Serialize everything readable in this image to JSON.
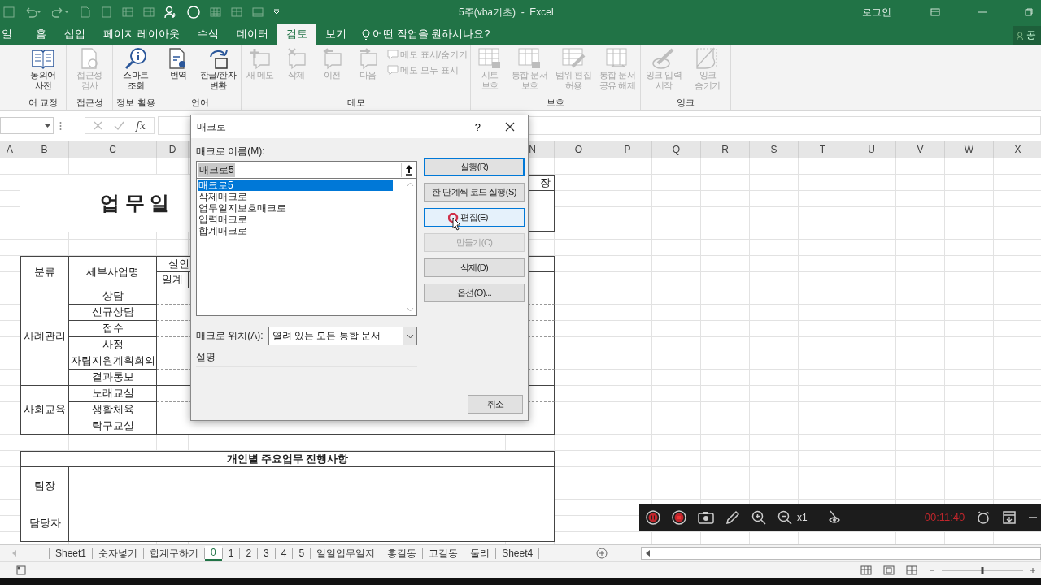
{
  "window": {
    "title": "5주(vba기초)  -  Excel",
    "sign_in": "로그인"
  },
  "ribbon_tabs": [
    {
      "label": "일",
      "selected": false
    },
    {
      "label": "홈",
      "selected": false
    },
    {
      "label": "삽입",
      "selected": false
    },
    {
      "label": "페이지 레이아웃",
      "selected": false
    },
    {
      "label": "수식",
      "selected": false
    },
    {
      "label": "데이터",
      "selected": false
    },
    {
      "label": "검토",
      "selected": true
    },
    {
      "label": "보기",
      "selected": false
    }
  ],
  "tell_me": {
    "placeholder": "어떤 작업을 원하시나요?"
  },
  "share": {
    "label": "공"
  },
  "ribbon_groups": [
    {
      "label": "어 교정",
      "buttons": [
        {
          "label": "동의어 사전",
          "kind": "large",
          "disabled": false
        }
      ]
    },
    {
      "label": "접근성",
      "buttons": [
        {
          "label": "접근성 검사",
          "kind": "large",
          "disabled": true
        }
      ]
    },
    {
      "label": "정보 활용",
      "buttons": [
        {
          "label": "스마트 조회",
          "kind": "large",
          "disabled": false
        }
      ]
    },
    {
      "label": "언어",
      "buttons": [
        {
          "label": "번역",
          "kind": "large",
          "disabled": false
        },
        {
          "label": "한글/한자 변환",
          "kind": "large",
          "disabled": false
        }
      ]
    },
    {
      "label": "메모",
      "buttons": [
        {
          "label": "새 메모",
          "kind": "large",
          "disabled": true
        },
        {
          "label": "삭제",
          "kind": "large",
          "disabled": true
        },
        {
          "label": "이전",
          "kind": "large",
          "disabled": true
        },
        {
          "label": "다음",
          "kind": "large",
          "disabled": true
        },
        {
          "label": "메모 표시/숨기기",
          "kind": "small",
          "disabled": true
        },
        {
          "label": "메모 모두 표시",
          "kind": "small",
          "disabled": true
        }
      ]
    },
    {
      "label": "보호",
      "buttons": [
        {
          "label": "시트 보호",
          "kind": "large",
          "disabled": true
        },
        {
          "label": "통합 문서 보호",
          "kind": "large",
          "disabled": true
        },
        {
          "label": "범위 편집 허용",
          "kind": "large",
          "disabled": true
        },
        {
          "label": "통합 문서 공유 해제",
          "kind": "large",
          "disabled": true
        }
      ]
    },
    {
      "label": "잉크",
      "buttons": [
        {
          "label": "잉크 입력 시작",
          "kind": "large",
          "disabled": true
        },
        {
          "label": "잉크 숨기기",
          "kind": "large",
          "disabled": true
        }
      ]
    }
  ],
  "formula_bar": {
    "function_label": "fx"
  },
  "sheet": {
    "columns": [
      "A",
      "B",
      "C",
      "D",
      "N",
      "O",
      "P",
      "Q",
      "R",
      "S",
      "T",
      "U",
      "V",
      "W",
      "X"
    ],
    "title": "업 무 일",
    "approval_label": "장",
    "header": {
      "category": "분류",
      "item": "세부사업명",
      "count": "실인",
      "daily": "일계"
    },
    "groups": [
      {
        "category": "사례관리",
        "items": [
          "상담",
          "신규상담",
          "접수",
          "사정",
          "자립지원계획회의",
          "결과통보"
        ]
      },
      {
        "category": "사회교육",
        "items": [
          "노래교실",
          "생활체육",
          "탁구교실"
        ]
      }
    ],
    "progress_title": "개인별 주요업무 진행사항",
    "staff_rows": [
      "팀장",
      "담당자"
    ]
  },
  "dialog": {
    "title": "매크로",
    "help": "?",
    "name_label": "매크로 이름(M):",
    "name_value": "매크로5",
    "macros": [
      {
        "name": "매크로5",
        "selected": true
      },
      {
        "name": "삭제매크로",
        "selected": false
      },
      {
        "name": "업무일지보호매크로",
        "selected": false
      },
      {
        "name": "입력매크로",
        "selected": false
      },
      {
        "name": "합계매크로",
        "selected": false
      }
    ],
    "buttons": [
      {
        "label": "실행(R)",
        "default": true,
        "hovered": false,
        "disabled": false
      },
      {
        "label": "한 단계씩 코드 실행(S)",
        "default": false,
        "hovered": false,
        "disabled": false
      },
      {
        "label": "편집(E)",
        "default": false,
        "hovered": true,
        "disabled": false
      },
      {
        "label": "만들기(C)",
        "default": false,
        "hovered": false,
        "disabled": true
      },
      {
        "label": "삭제(D)",
        "default": false,
        "hovered": false,
        "disabled": false
      },
      {
        "label": "옵션(O)...",
        "default": false,
        "hovered": false,
        "disabled": false
      }
    ],
    "location_label": "매크로 위치(A):",
    "location_value": "열려 있는 모든 통합 문서",
    "description_label": "설명",
    "cancel": "취소"
  },
  "sheet_tabs": [
    {
      "label": "Sheet1",
      "selected": false
    },
    {
      "label": "숫자넣기",
      "selected": false
    },
    {
      "label": "합계구하기",
      "selected": false
    },
    {
      "label": "0",
      "selected": true
    },
    {
      "label": "1",
      "selected": false
    },
    {
      "label": "2",
      "selected": false
    },
    {
      "label": "3",
      "selected": false
    },
    {
      "label": "4",
      "selected": false
    },
    {
      "label": "5",
      "selected": false
    },
    {
      "label": "일일업무일지",
      "selected": false
    },
    {
      "label": "홍길동",
      "selected": false
    },
    {
      "label": "고길동",
      "selected": false
    },
    {
      "label": "둘리",
      "selected": false
    },
    {
      "label": "Sheet4",
      "selected": false
    }
  ],
  "recorder": {
    "zoom_label": "x1",
    "timer": "00:11:40"
  },
  "zoom_slider": {
    "level": 0.5
  }
}
